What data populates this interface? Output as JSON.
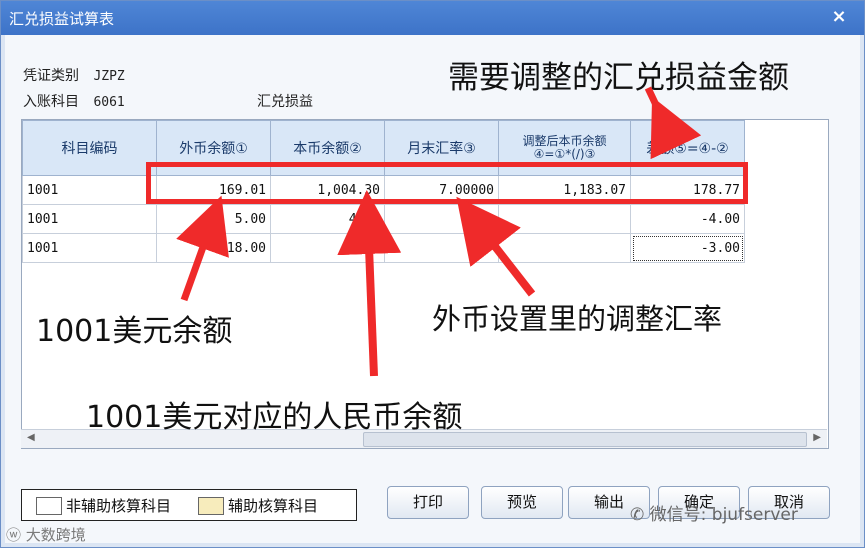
{
  "window": {
    "title": "汇兑损益试算表",
    "close_label": "×"
  },
  "info": {
    "voucher_type_label": "凭证类别",
    "voucher_type_value": "JZPZ",
    "account_label": "入账科目",
    "account_code": "6061",
    "account_name": "汇兑损益"
  },
  "table": {
    "headers": [
      "科目编码",
      "外币余额①",
      "本币余额②",
      "月末汇率③",
      "调整后本币余额",
      "④=①*(/)③",
      "差额⑤=④-②"
    ],
    "rows": [
      {
        "code": "1001",
        "fc_balance": "169.01",
        "lc_balance": "1,004.30",
        "rate": "7.00000",
        "adjusted": "1,183.07",
        "diff": "178.77"
      },
      {
        "code": "1001",
        "fc_balance": "5.00",
        "lc_balance": "4.00",
        "rate": "",
        "adjusted": "",
        "diff": "-4.00"
      },
      {
        "code": "1001",
        "fc_balance": "18.00",
        "lc_balance": "3.00",
        "rate": "",
        "adjusted": "",
        "diff": "-3.00"
      }
    ]
  },
  "legend": {
    "non_aux_label": "非辅助核算科目",
    "aux_label": "辅助核算科目",
    "non_aux_color": "#ffffff",
    "aux_color": "#f7ecbc"
  },
  "buttons": {
    "print": "打印",
    "preview": "预览",
    "output": "输出",
    "confirm": "确定",
    "cancel": "取消"
  },
  "annotations": {
    "top": "需要调整的汇兑损益金额",
    "rate": "外币设置里的调整汇率",
    "usd_balance": "1001美元余额",
    "rmb_balance": "1001美元对应的人民币余额",
    "color": "#ef2a2a"
  },
  "watermarks": {
    "left": "大数跨境",
    "right": "微信号: bjufserver"
  }
}
